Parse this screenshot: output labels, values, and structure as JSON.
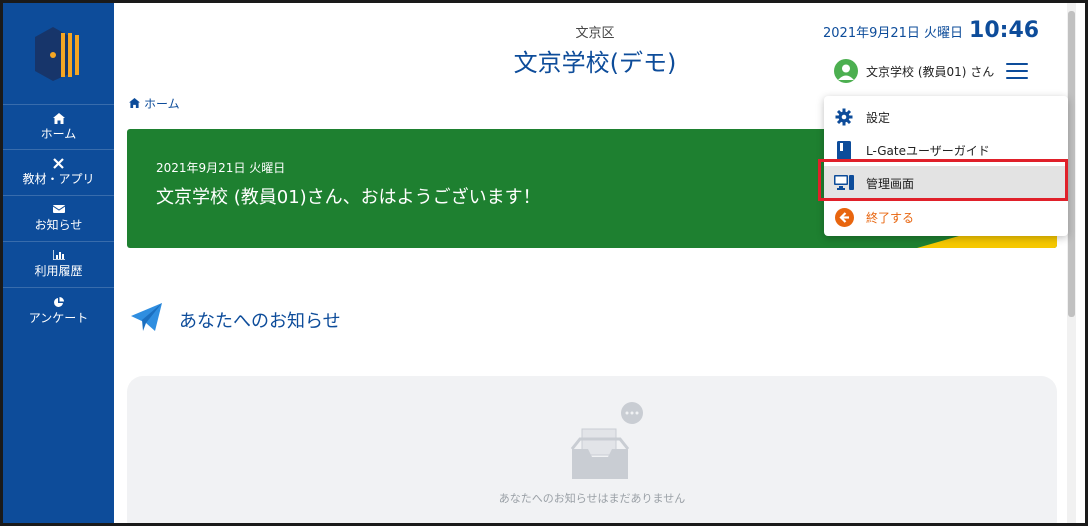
{
  "header": {
    "ward": "文京区",
    "school": "文京学校(デモ)",
    "date": "2021年9月21日 火曜日",
    "time": "10:46",
    "user_name": "文京学校 (教員01) さん"
  },
  "sidebar": {
    "items": [
      {
        "icon": "home-icon",
        "label": "ホーム"
      },
      {
        "icon": "close-icon",
        "label": "教材・アプリ"
      },
      {
        "icon": "envelope-icon",
        "label": "お知らせ"
      },
      {
        "icon": "bar-chart-icon",
        "label": "利用履歴"
      },
      {
        "icon": "pie-chart-icon",
        "label": "アンケート"
      }
    ]
  },
  "breadcrumb": {
    "label": "ホーム"
  },
  "banner": {
    "date": "2021年9月21日 火曜日",
    "greeting": "文京学校 (教員01)さん、おはようございます！"
  },
  "notices": {
    "title": "あなたへのお知らせ",
    "empty_text": "あなたへのお知らせはまだありません"
  },
  "menu": {
    "items": [
      {
        "icon": "gear-icon",
        "label": "設定"
      },
      {
        "icon": "book-icon",
        "label": "L-Gateユーザーガイド"
      },
      {
        "icon": "monitor-icon",
        "label": "管理画面",
        "highlighted": true
      },
      {
        "icon": "exit-icon",
        "label": "終了する"
      }
    ]
  },
  "colors": {
    "brand_blue": "#0d4c9a",
    "banner_green": "#1e8030",
    "accent_yellow": "#f6c800",
    "exit_orange": "#e8650e",
    "highlight_red": "#e0202a"
  }
}
